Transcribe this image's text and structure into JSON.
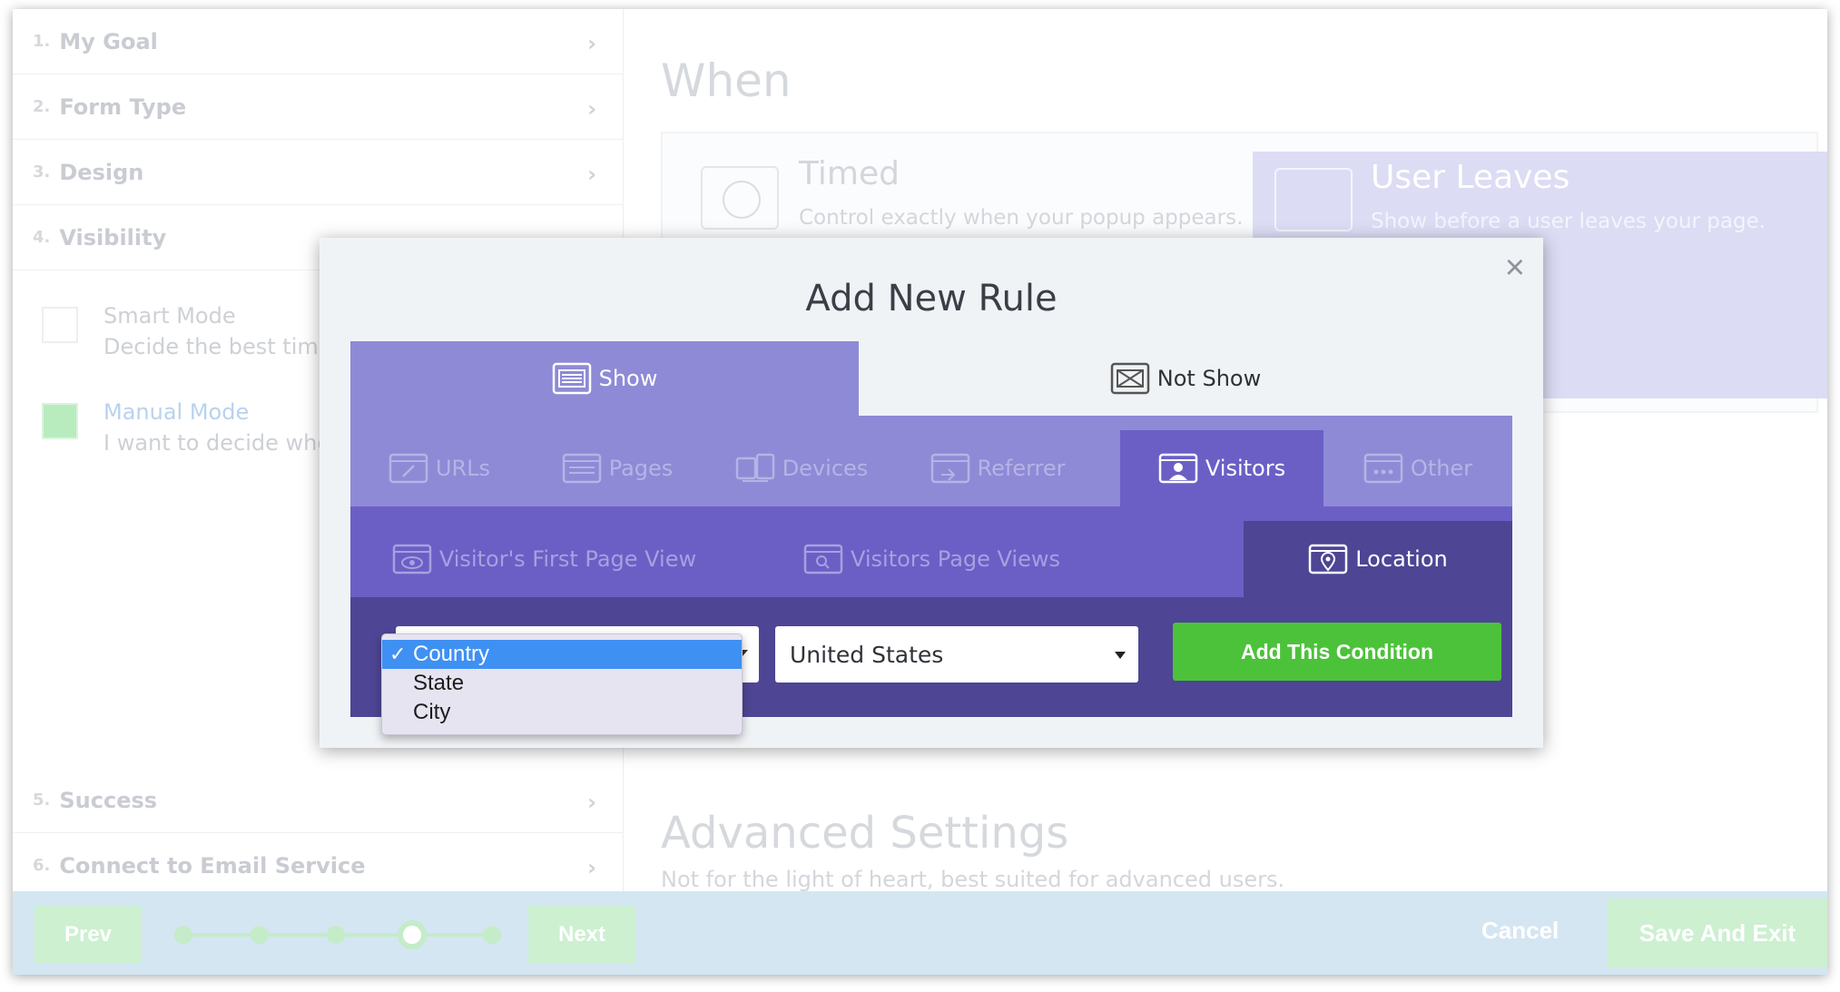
{
  "sidebar": {
    "steps": [
      {
        "num": "1.",
        "label": "My Goal"
      },
      {
        "num": "2.",
        "label": "Form Type"
      },
      {
        "num": "3.",
        "label": "Design"
      },
      {
        "num": "4.",
        "label": "Visibility"
      },
      {
        "num": "5.",
        "label": "Success"
      },
      {
        "num": "6.",
        "label": "Connect to Email Service"
      }
    ],
    "modes": [
      {
        "title": "Smart Mode",
        "desc": "Decide the best time ar"
      },
      {
        "title": "Manual Mode",
        "desc": "I want to decide where"
      }
    ]
  },
  "main": {
    "when_title": "When",
    "timed": {
      "title": "Timed",
      "desc": "Control exactly when your popup appears."
    },
    "leaves": {
      "title": "User Leaves",
      "desc": "Show before a user leaves your page."
    },
    "advanced": {
      "title": "Advanced Settings",
      "desc": "Not for the light of heart, best suited for advanced users."
    }
  },
  "footer": {
    "prev": "Prev",
    "next": "Next",
    "cancel": "Cancel",
    "save": "Save And Exit",
    "progress_step": 4,
    "progress_total": 5
  },
  "modal": {
    "title": "Add New Rule",
    "close": "×",
    "top_tabs": [
      {
        "label": "Show",
        "icon": "list-window-icon"
      },
      {
        "label": "Not Show",
        "icon": "crossed-window-icon"
      }
    ],
    "category_tabs": [
      {
        "label": "URLs",
        "icon": "link-window-icon"
      },
      {
        "label": "Pages",
        "icon": "pages-window-icon"
      },
      {
        "label": "Devices",
        "icon": "devices-icon"
      },
      {
        "label": "Referrer",
        "icon": "referrer-window-icon"
      },
      {
        "label": "Visitors",
        "icon": "visitor-window-icon"
      },
      {
        "label": "Other",
        "icon": "dots-window-icon"
      }
    ],
    "sub_tabs": [
      {
        "label": "Visitor's First Page View",
        "icon": "eye-window-icon"
      },
      {
        "label": "Visitors Page Views",
        "icon": "search-window-icon"
      },
      {
        "label": "Location",
        "icon": "location-window-icon"
      }
    ],
    "location_value": "United States",
    "add_condition": "Add This Condition",
    "dropdown_options": [
      {
        "label": "Country",
        "check": "✓"
      },
      {
        "label": "State"
      },
      {
        "label": "City"
      }
    ]
  },
  "colors": {
    "show_tab": "#8e8ad6",
    "sub_row": "#6b5fc6",
    "active_row": "#4e4594",
    "add_button": "#4cc23a",
    "dropdown_selected": "#3f90f3"
  }
}
